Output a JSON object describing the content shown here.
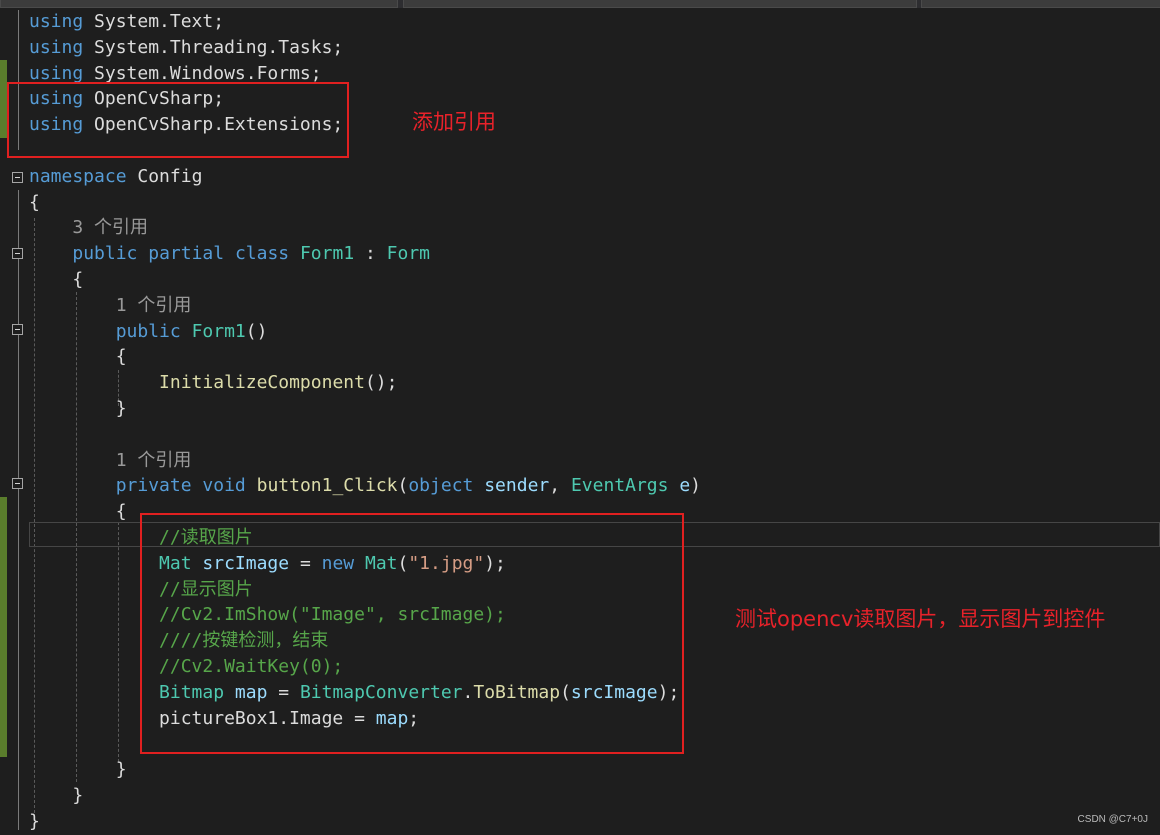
{
  "editor": {
    "lines": [
      [
        {
          "t": "using",
          "c": "kw"
        },
        {
          "t": " System.Text;",
          "c": "plain"
        }
      ],
      [
        {
          "t": "using",
          "c": "kw"
        },
        {
          "t": " System.Threading.Tasks;",
          "c": "plain"
        }
      ],
      [
        {
          "t": "using",
          "c": "kw"
        },
        {
          "t": " System.Windows.Forms;",
          "c": "plain"
        }
      ],
      [
        {
          "t": "using",
          "c": "kw"
        },
        {
          "t": " OpenCvSharp;",
          "c": "plain"
        }
      ],
      [
        {
          "t": "using",
          "c": "kw"
        },
        {
          "t": " OpenCvSharp.Extensions;",
          "c": "plain"
        }
      ],
      [],
      [
        {
          "t": "namespace",
          "c": "kw"
        },
        {
          "t": " Config",
          "c": "plain"
        }
      ],
      [
        {
          "t": "{",
          "c": "plain"
        }
      ],
      [
        {
          "t": "    3 个引用",
          "c": "ref"
        }
      ],
      [
        {
          "t": "    ",
          "c": "plain"
        },
        {
          "t": "public",
          "c": "kw"
        },
        {
          "t": " ",
          "c": "plain"
        },
        {
          "t": "partial",
          "c": "kw"
        },
        {
          "t": " ",
          "c": "plain"
        },
        {
          "t": "class",
          "c": "kw"
        },
        {
          "t": " ",
          "c": "plain"
        },
        {
          "t": "Form1",
          "c": "ty"
        },
        {
          "t": " : ",
          "c": "plain"
        },
        {
          "t": "Form",
          "c": "ty"
        }
      ],
      [
        {
          "t": "    {",
          "c": "plain"
        }
      ],
      [
        {
          "t": "        1 个引用",
          "c": "ref"
        }
      ],
      [
        {
          "t": "        ",
          "c": "plain"
        },
        {
          "t": "public",
          "c": "kw"
        },
        {
          "t": " ",
          "c": "plain"
        },
        {
          "t": "Form1",
          "c": "ty"
        },
        {
          "t": "()",
          "c": "plain"
        }
      ],
      [
        {
          "t": "        {",
          "c": "plain"
        }
      ],
      [
        {
          "t": "            ",
          "c": "plain"
        },
        {
          "t": "InitializeComponent",
          "c": "fn"
        },
        {
          "t": "();",
          "c": "plain"
        }
      ],
      [
        {
          "t": "        }",
          "c": "plain"
        }
      ],
      [],
      [
        {
          "t": "        1 个引用",
          "c": "ref"
        }
      ],
      [
        {
          "t": "        ",
          "c": "plain"
        },
        {
          "t": "private",
          "c": "kw"
        },
        {
          "t": " ",
          "c": "plain"
        },
        {
          "t": "void",
          "c": "kw"
        },
        {
          "t": " ",
          "c": "plain"
        },
        {
          "t": "button1_Click",
          "c": "fn"
        },
        {
          "t": "(",
          "c": "plain"
        },
        {
          "t": "object",
          "c": "kw"
        },
        {
          "t": " ",
          "c": "plain"
        },
        {
          "t": "sender",
          "c": "var"
        },
        {
          "t": ", ",
          "c": "plain"
        },
        {
          "t": "EventArgs",
          "c": "ty"
        },
        {
          "t": " ",
          "c": "plain"
        },
        {
          "t": "e",
          "c": "var"
        },
        {
          "t": ")",
          "c": "plain"
        }
      ],
      [
        {
          "t": "        {",
          "c": "plain"
        }
      ],
      [
        {
          "t": "            //读取图片",
          "c": "cm"
        }
      ],
      [
        {
          "t": "            ",
          "c": "plain"
        },
        {
          "t": "Mat",
          "c": "ty"
        },
        {
          "t": " ",
          "c": "plain"
        },
        {
          "t": "srcImage",
          "c": "var"
        },
        {
          "t": " = ",
          "c": "plain"
        },
        {
          "t": "new",
          "c": "kw"
        },
        {
          "t": " ",
          "c": "plain"
        },
        {
          "t": "Mat",
          "c": "ty"
        },
        {
          "t": "(",
          "c": "plain"
        },
        {
          "t": "\"1.jpg\"",
          "c": "str"
        },
        {
          "t": ");",
          "c": "plain"
        }
      ],
      [
        {
          "t": "            //显示图片",
          "c": "cm"
        }
      ],
      [
        {
          "t": "            //Cv2.ImShow(\"Image\", srcImage);",
          "c": "cm"
        }
      ],
      [
        {
          "t": "            ////按键检测，结束",
          "c": "cm"
        }
      ],
      [
        {
          "t": "            //Cv2.WaitKey(0);",
          "c": "cm"
        }
      ],
      [
        {
          "t": "            ",
          "c": "plain"
        },
        {
          "t": "Bitmap",
          "c": "ty"
        },
        {
          "t": " ",
          "c": "plain"
        },
        {
          "t": "map",
          "c": "var"
        },
        {
          "t": " = ",
          "c": "plain"
        },
        {
          "t": "BitmapConverter",
          "c": "ty"
        },
        {
          "t": ".",
          "c": "plain"
        },
        {
          "t": "ToBitmap",
          "c": "fn"
        },
        {
          "t": "(",
          "c": "plain"
        },
        {
          "t": "srcImage",
          "c": "var"
        },
        {
          "t": ");",
          "c": "plain"
        }
      ],
      [
        {
          "t": "            pictureBox1.Image = ",
          "c": "plain"
        },
        {
          "t": "map",
          "c": "var"
        },
        {
          "t": ";",
          "c": "plain"
        }
      ],
      [],
      [
        {
          "t": "        }",
          "c": "plain"
        }
      ],
      [
        {
          "t": "    }",
          "c": "plain"
        }
      ],
      [
        {
          "t": "}",
          "c": "plain"
        }
      ]
    ]
  },
  "annotations": {
    "add_reference": "添加引用",
    "test_opencv": "测试opencv读取图片，显示图片到控件"
  },
  "watermark": "CSDN @C7+0J",
  "colors": {
    "keyword": "#569cd6",
    "type": "#4ec9b0",
    "method": "#dcdcaa",
    "string": "#d69d85",
    "comment": "#57a64a",
    "annotation_red": "#e02020"
  }
}
